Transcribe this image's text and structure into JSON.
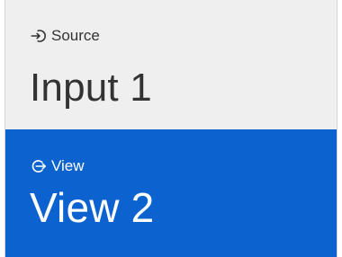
{
  "source": {
    "label": "Source",
    "value": "Input 1",
    "icon": "login-arrow-icon"
  },
  "view": {
    "label": "View",
    "value": "View 2",
    "icon": "logout-arrow-icon"
  },
  "colors": {
    "source_background": "#efefef",
    "view_background": "#0c63cf",
    "view_text": "#ffffff",
    "source_text": "#333333"
  }
}
